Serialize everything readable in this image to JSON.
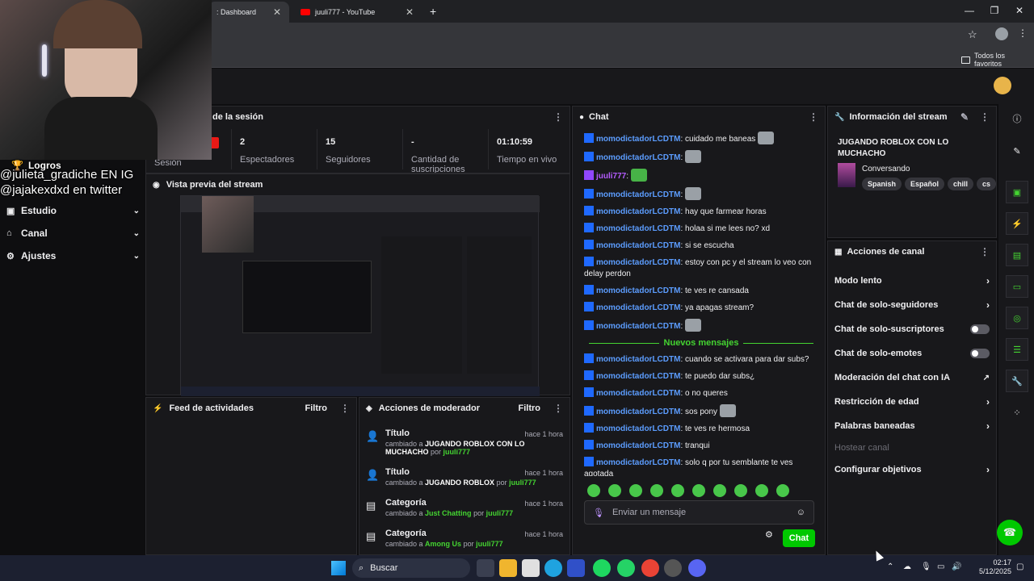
{
  "browser": {
    "tabs": [
      {
        "label": ": Dashboard"
      },
      {
        "label": "juuli777 - YouTube"
      }
    ],
    "bookmarks_label": "Todos los favoritos"
  },
  "webcam_overlay": {
    "achievements": "Logros",
    "line1": "@julieta_gradiche EN IG",
    "line2": "@jajakexdxd en twitter"
  },
  "sidebar": {
    "items": [
      {
        "label": "Estudio"
      },
      {
        "label": "Canal"
      },
      {
        "label": "Ajustes"
      }
    ]
  },
  "session": {
    "title": "de la sesión",
    "stats": [
      {
        "value": "",
        "label": "Sesión"
      },
      {
        "value": "2",
        "label": "Espectadores"
      },
      {
        "value": "15",
        "label": "Seguidores"
      },
      {
        "value": "-",
        "label": "Cantidad de suscripciones"
      },
      {
        "value": "01:10:59",
        "label": "Tiempo en vivo"
      }
    ]
  },
  "preview": {
    "title": "Vista previa del stream"
  },
  "activity": {
    "title": "Feed de actividades",
    "filter": "Filtro"
  },
  "mod_actions": {
    "title": "Acciones de moderador",
    "filter": "Filtro",
    "items": [
      {
        "title": "Título",
        "time": "hace 1 hora",
        "prefix": "cambiado a",
        "value": "JUGANDO ROBLOX CON LO MUCHACHO",
        "by": "por",
        "user": "juuli777"
      },
      {
        "title": "Título",
        "time": "hace 1 hora",
        "prefix": "cambiado a",
        "value": "JUGANDO ROBLOX",
        "by": "por",
        "user": "juuli777"
      },
      {
        "title": "Categoría",
        "time": "hace 1 hora",
        "prefix": "cambiado a",
        "value": "Just Chatting",
        "by": "por",
        "user": "juuli777"
      },
      {
        "title": "Categoría",
        "time": "hace 1 hora",
        "prefix": "cambiado a",
        "value": "Among Us",
        "by": "por",
        "user": "juuli777"
      }
    ]
  },
  "chat": {
    "title": "Chat",
    "messages_before": [
      {
        "user": "momodictadorLCDTM",
        "text": ": cuidado me baneas",
        "emote": true
      },
      {
        "user": "momodictadorLCDTM",
        "text": ":",
        "emote": true
      },
      {
        "user": "juuli777",
        "text": ":",
        "emote": true,
        "mod": true
      },
      {
        "user": "momodictadorLCDTM",
        "text": ":",
        "emote": true
      },
      {
        "user": "momodictadorLCDTM",
        "text": ": hay que farmear horas"
      },
      {
        "user": "momodictadorLCDTM",
        "text": ": holaa si me lees no? xd"
      },
      {
        "user": "momodictadorLCDTM",
        "text": ": si se escucha"
      },
      {
        "user": "momodictadorLCDTM",
        "text": ": estoy con pc y el stream lo veo con delay perdon"
      },
      {
        "user": "momodictadorLCDTM",
        "text": ": te ves re cansada"
      },
      {
        "user": "momodictadorLCDTM",
        "text": ": ya apagas stream?"
      },
      {
        "user": "momodictadorLCDTM",
        "text": ":",
        "emote": true
      }
    ],
    "new_messages_label": "Nuevos mensajes",
    "messages_after": [
      {
        "user": "momodictadorLCDTM",
        "text": ": cuando se activara para dar subs?"
      },
      {
        "user": "momodictadorLCDTM",
        "text": ": te puedo dar subs¿"
      },
      {
        "user": "momodictadorLCDTM",
        "text": ": o no queres"
      },
      {
        "user": "momodictadorLCDTM",
        "text": ": sos pony",
        "emote": true
      },
      {
        "user": "momodictadorLCDTM",
        "text": ": te ves re hermosa"
      },
      {
        "user": "momodictadorLCDTM",
        "text": ": tranqui"
      },
      {
        "user": "momodictadorLCDTM",
        "text": ": solo q por tu semblante te ves agotada"
      }
    ],
    "input_placeholder": "Enviar un mensaje",
    "send_label": "Chat"
  },
  "stream_info": {
    "title": "Información del stream",
    "stream_title": "JUGANDO ROBLOX CON LO MUCHACHO",
    "category": "Conversando",
    "tags": [
      "Spanish",
      "Español",
      "chill",
      "cs"
    ]
  },
  "channel_actions": {
    "title": "Acciones de canal",
    "items": [
      {
        "label": "Modo lento",
        "kind": "chev"
      },
      {
        "label": "Chat de solo-seguidores",
        "kind": "chev"
      },
      {
        "label": "Chat de solo-suscriptores",
        "kind": "toggle"
      },
      {
        "label": "Chat de solo-emotes",
        "kind": "toggle"
      },
      {
        "label": "Moderación del chat con IA",
        "kind": "ext"
      },
      {
        "label": "Restricción de edad",
        "kind": "chev"
      },
      {
        "label": "Palabras baneadas",
        "kind": "chev"
      },
      {
        "label": "Hostear canal",
        "kind": "disabled"
      },
      {
        "label": "Configurar objetivos",
        "kind": "chev"
      }
    ]
  },
  "taskbar": {
    "search_label": "Buscar",
    "time": "02:17",
    "date": "5/12/2025"
  }
}
